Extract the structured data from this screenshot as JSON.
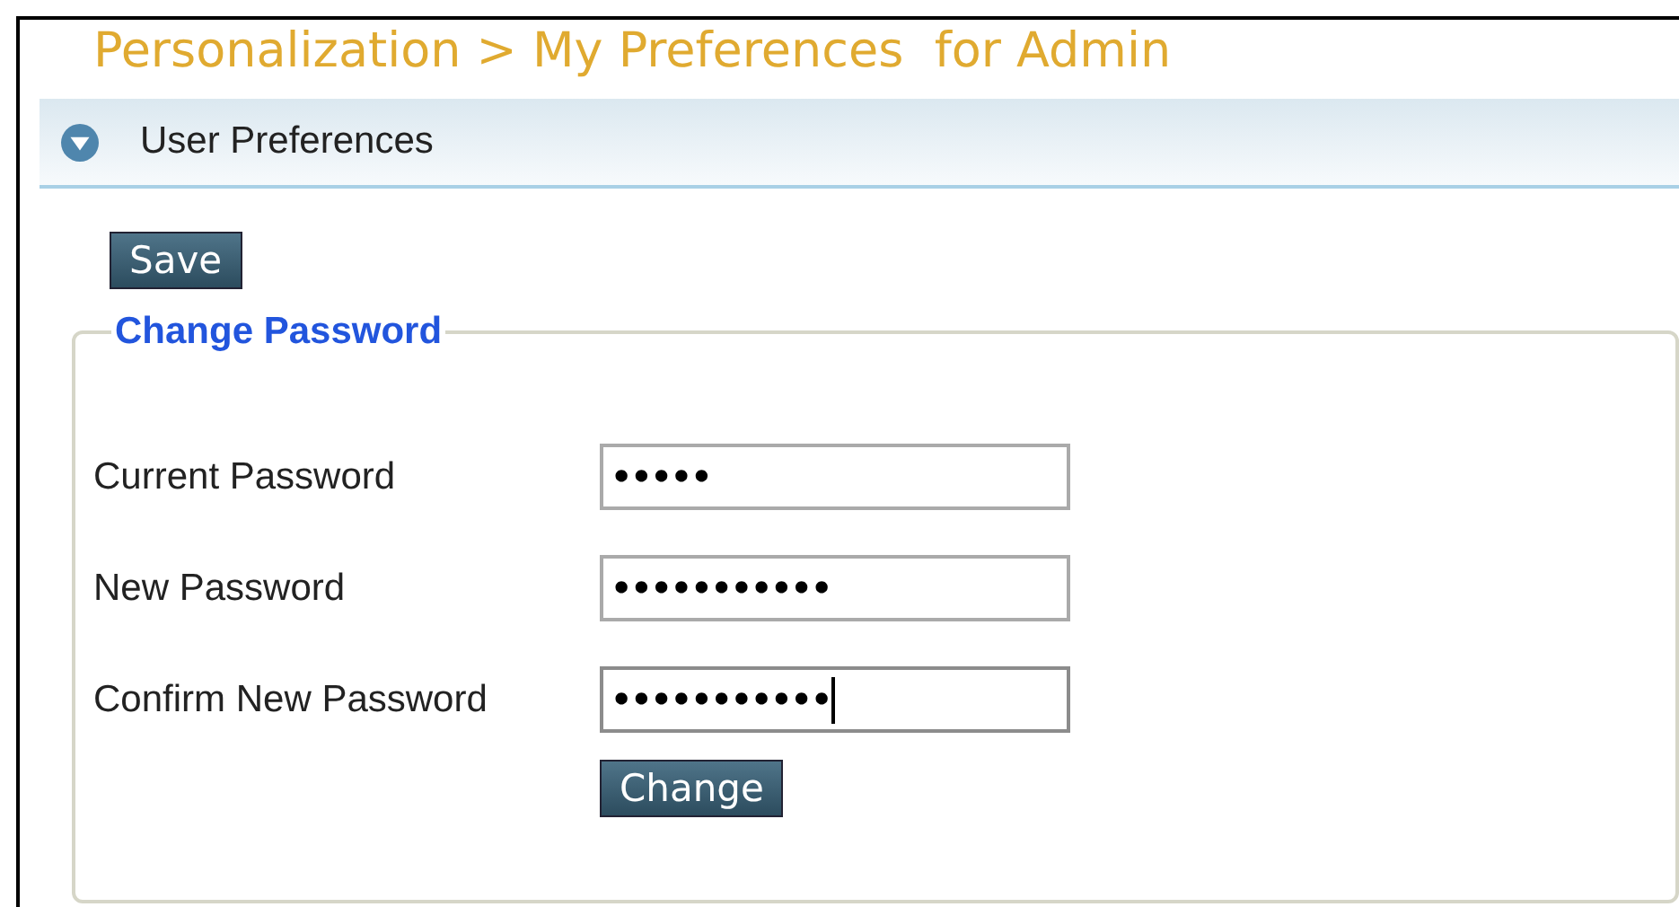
{
  "page": {
    "title": "Personalization > My Preferences  for Admin"
  },
  "section": {
    "title": "User Preferences",
    "expanded": true
  },
  "save_button": "Save",
  "change_password": {
    "legend": "Change Password",
    "fields": [
      {
        "label": "Current Password",
        "value": "•••••",
        "focused": false
      },
      {
        "label": "New Password",
        "value": "•••••••••••",
        "focused": false
      },
      {
        "label": "Confirm New Password",
        "value": "•••••••••••",
        "focused": true
      }
    ],
    "button": "Change"
  }
}
